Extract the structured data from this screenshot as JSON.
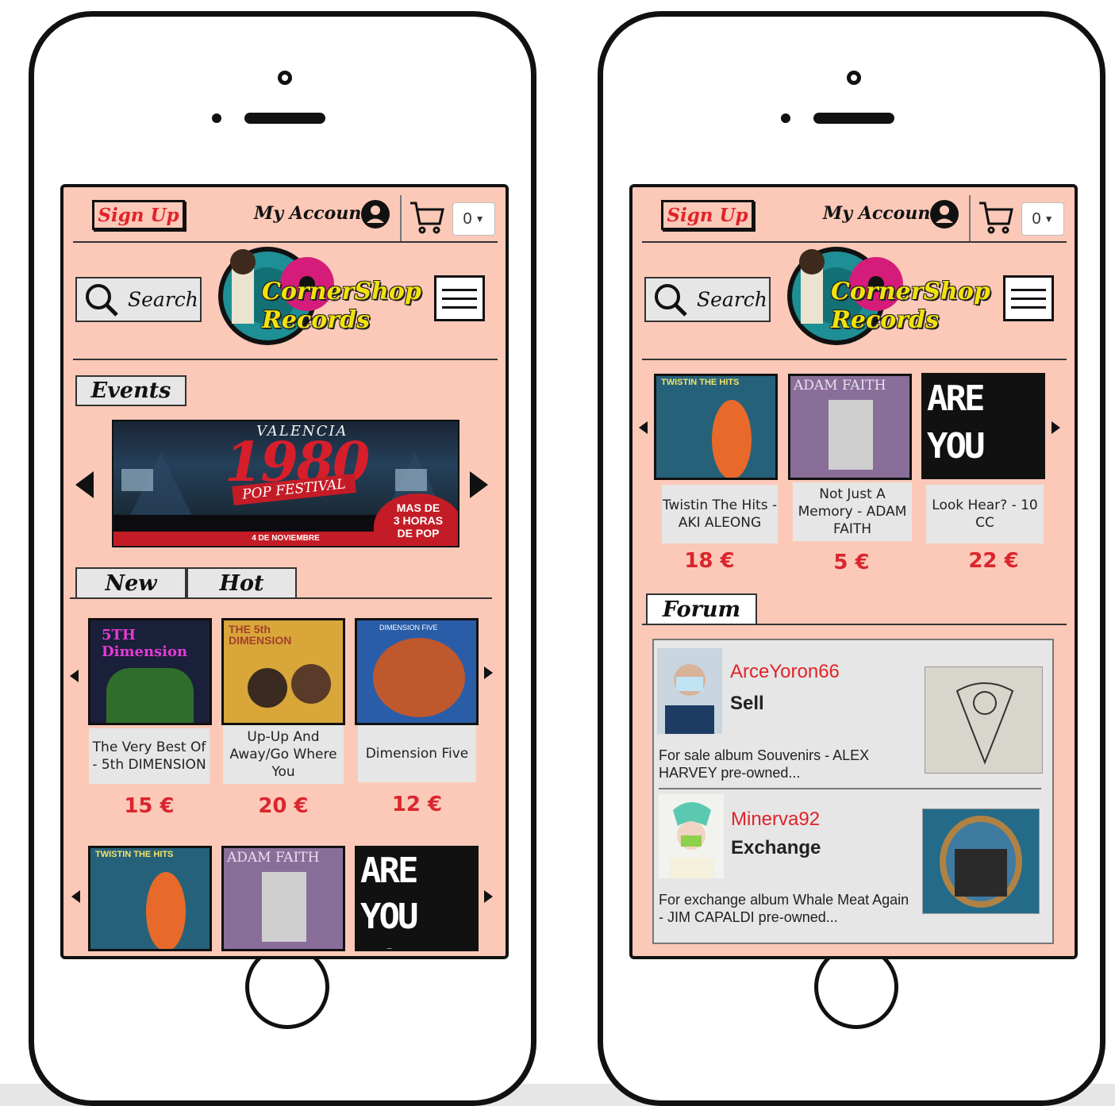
{
  "header": {
    "signup_label": "Sign Up",
    "account_label": "My Account",
    "cart_count": "0",
    "search_label": "Search",
    "logo_line1": "CornerShop",
    "logo_line2": "Records"
  },
  "left_screen": {
    "events_tab": "Events",
    "event": {
      "city": "VALENCIA",
      "year": "1980",
      "festival": "POP FESTIVAL",
      "date": "4 DE NOVIEMBRE",
      "badge_line1": "MAS DE",
      "badge_line2": "3 HORAS",
      "badge_line3": "DE POP"
    },
    "tabs": [
      "New",
      "Hot"
    ],
    "products": [
      {
        "caption": "The Very Best Of - 5th DIMENSION",
        "price": "15 €",
        "cover_title": "5TH Dimension"
      },
      {
        "caption": "Up-Up And Away/Go Where You",
        "price": "20 €",
        "cover_title": "THE 5th DIMENSION"
      },
      {
        "caption": "Dimension Five",
        "price": "12 €",
        "cover_title": "DIMENSION FIVE"
      }
    ],
    "row2_covers": [
      "TWISTIN THE HITS",
      "ADAM FAITH",
      "ARE YOU NORMAL"
    ]
  },
  "right_screen": {
    "products": [
      {
        "caption": "Twistin The Hits - AKI ALEONG",
        "price": "18 €",
        "cover_title": "TWISTIN THE HITS"
      },
      {
        "caption": "Not Just A Memory - ADAM FAITH",
        "price": "5 €",
        "cover_title": "ADAM FAITH"
      },
      {
        "caption": "Look Hear? - 10 CC",
        "price": "22 €",
        "cover_title": "ARE YOU NORMAL"
      }
    ],
    "forum_tab": "Forum",
    "posts": [
      {
        "user": "ArceYoron66",
        "type": "Sell",
        "text": "For sale album Souvenirs - ALEX HARVEY pre-owned..."
      },
      {
        "user": "Minerva92",
        "type": "Exchange",
        "text": "For exchange album Whale Meat Again - JIM CAPALDI pre-owned..."
      }
    ]
  },
  "colors": {
    "screen_bg": "#fcc9b8",
    "accent_red": "#e0232a",
    "price_red": "#d9262e",
    "caption_bg": "#e6e6e6"
  }
}
